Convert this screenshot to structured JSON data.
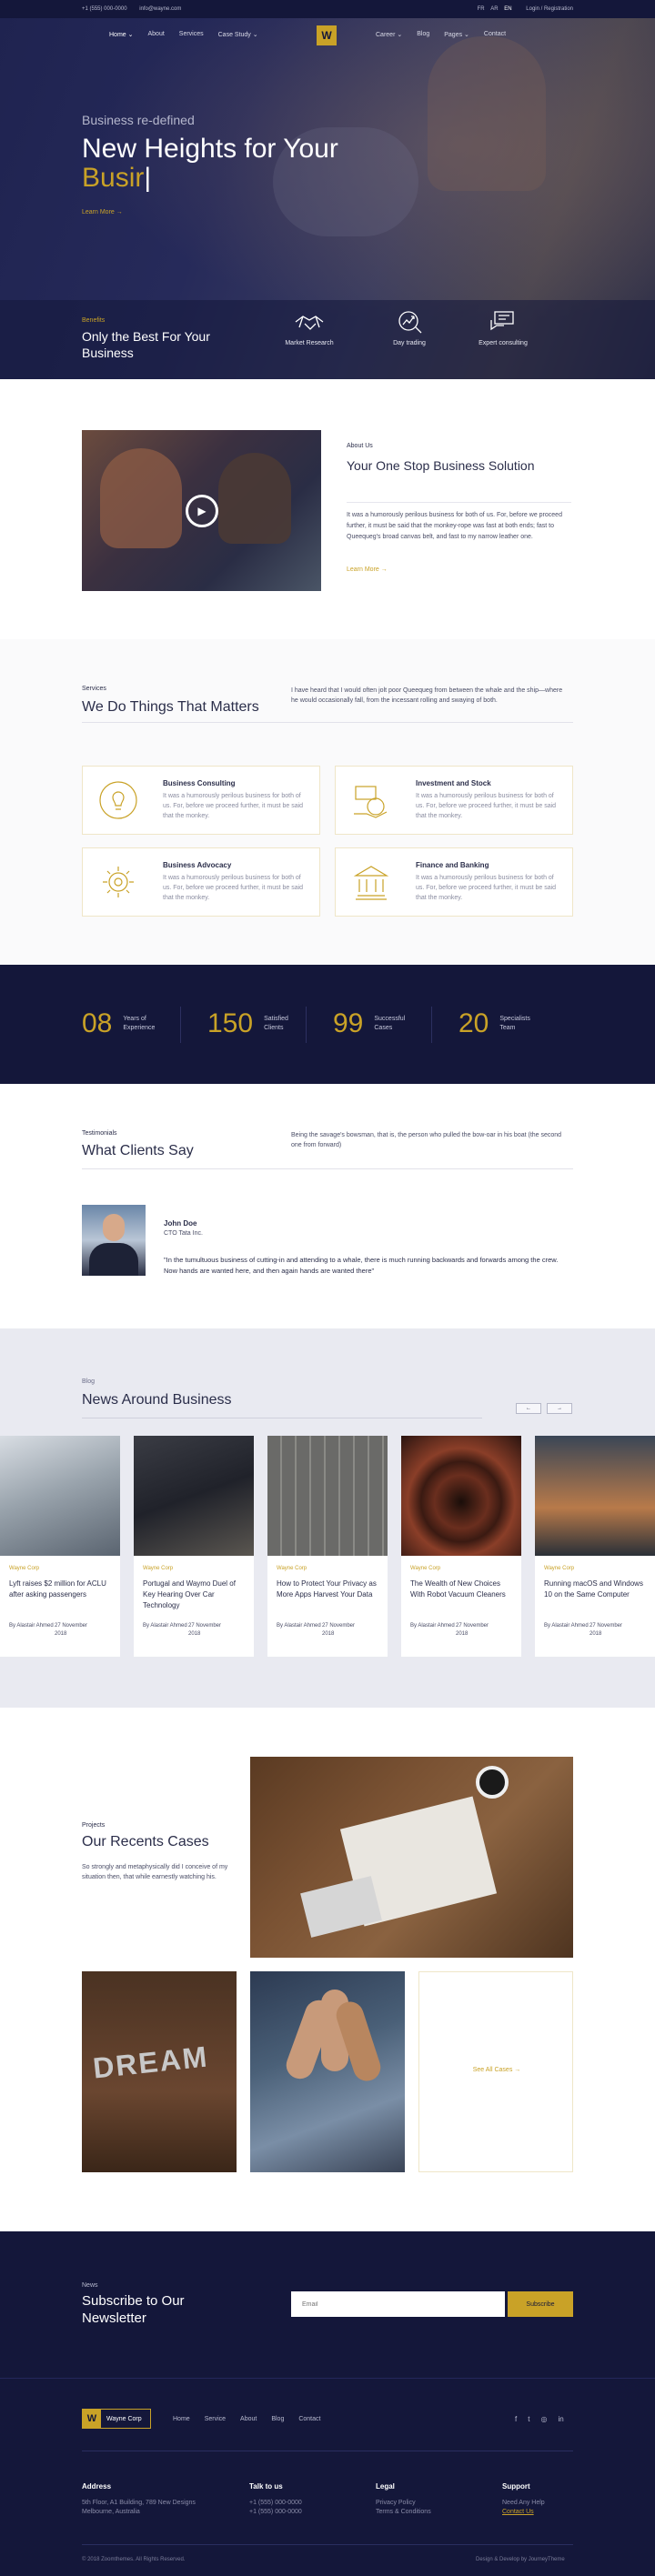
{
  "topbar": {
    "phone": "+1 (555) 000-0000",
    "email": "info@wayne.com",
    "langs": [
      "FR",
      "AR",
      "EN"
    ],
    "auth": "Login / Registration"
  },
  "nav": {
    "left": [
      "Home ⌄",
      "About",
      "Services",
      "Case Study ⌄"
    ],
    "right": [
      "Career ⌄",
      "Blog",
      "Pages ⌄",
      "Contact"
    ],
    "logo_letter": "W"
  },
  "hero": {
    "kicker": "Business re-defined",
    "title_line1": "New Heights for Your",
    "title_line2": "Busir",
    "cta": "Learn More  →"
  },
  "benefits": {
    "label": "Benefits",
    "title": "Only the Best For Your Business",
    "items": [
      "Market Research",
      "Day trading",
      "Expert consulting"
    ]
  },
  "about": {
    "kicker": "About Us",
    "title": "Your One Stop Business Solution",
    "text": "It was a humorously perilous business for both of us. For, before we proceed further, it must be said that the monkey-rope was fast at both ends; fast to Queequeg's broad canvas belt, and fast to my narrow leather one.",
    "more": "Learn More  →"
  },
  "services": {
    "kicker": "Services",
    "title": "We Do Things That Matters",
    "desc": "I have heard that I would often jolt poor Queequeg from between the whale and the ship—where he would occasionally fall, from the incessant rolling and swaying of both.",
    "cards": [
      {
        "title": "Business Consulting",
        "text": "It was a humorously perilous business for both of us. For, before we proceed further, it must be said that the monkey."
      },
      {
        "title": "Investment and Stock",
        "text": "It was a humorously perilous business for both of us. For, before we proceed further, it must be said that the monkey."
      },
      {
        "title": "Business Advocacy",
        "text": "It was a humorously perilous business for both of us. For, before we proceed further, it must be said that the monkey."
      },
      {
        "title": "Finance and Banking",
        "text": "It was a humorously perilous business for both of us. For, before we proceed further, it must be said that the monkey."
      }
    ]
  },
  "stats": [
    {
      "num": "08",
      "label": "Years of Experience"
    },
    {
      "num": "150",
      "label": "Satisfied Clients"
    },
    {
      "num": "99",
      "label": "Successful Cases"
    },
    {
      "num": "20",
      "label": "Specialists Team"
    }
  ],
  "testimonials": {
    "kicker": "Testimonials",
    "title": "What Clients Say",
    "desc": "Being the savage's bowsman, that is, the person who pulled the bow-oar in his boat (the second one from forward)",
    "name": "John Doe",
    "role": "CTO Tata Inc.",
    "quote": "\"In the tumultuous business of cutting-in and attending to a whale, there is much running backwards and forwards among the crew. Now hands are wanted here, and then again hands are wanted there\""
  },
  "blog": {
    "kicker": "Blog",
    "title": "News Around Business",
    "prev": "←",
    "next": "→",
    "posts": [
      {
        "cat": "Wayne Corp",
        "title": "Lyft raises $2 million for ACLU after asking passengers",
        "by": "By Alastair Ahmed",
        "date": "27 November 2018"
      },
      {
        "cat": "Wayne Corp",
        "title": "Portugal and Waymo Duel of Key Hearing Over Car Technology",
        "by": "By Alastair Ahmed",
        "date": "27 November 2018"
      },
      {
        "cat": "Wayne Corp",
        "title": "How to Protect Your Privacy as More Apps Harvest Your Data",
        "by": "By Alastair Ahmed",
        "date": "27 November 2018"
      },
      {
        "cat": "Wayne Corp",
        "title": "The Wealth of New Choices With Robot Vacuum Cleaners",
        "by": "By Alastair Ahmed",
        "date": "27 November 2018"
      },
      {
        "cat": "Wayne Corp",
        "title": "Running macOS and Windows 10 on the Same Computer",
        "by": "By Alastair Ahmed",
        "date": "27 November 2018"
      }
    ]
  },
  "projects": {
    "kicker": "Projects",
    "title": "Our Recents Cases",
    "desc": "So strongly and metaphysically did I conceive of my situation then, that while earnestly watching his.",
    "img_word": "DREAM",
    "see_all": "See All Cases  →"
  },
  "newsletter": {
    "kicker": "News",
    "title": "Subscribe to Our Newsletter",
    "placeholder": "Email",
    "button": "Subscribe"
  },
  "footer": {
    "brand": "Wayne Corp",
    "brand_letter": "W",
    "nav": [
      "Home",
      "Service",
      "About",
      "Blog",
      "Contact"
    ],
    "social": [
      "f",
      "t",
      "◎",
      "in"
    ],
    "address": {
      "h": "Address",
      "l1": "5th Floor, A1 Building, 789 New Designs",
      "l2": "Melbourne, Australia"
    },
    "talk": {
      "h": "Talk to us",
      "l1": "+1 (555) 000-0000",
      "l2": "+1 (555) 000-0000"
    },
    "legal": {
      "h": "Legal",
      "l1": "Privacy Policy",
      "l2": "Terms & Conditions"
    },
    "support": {
      "h": "Support",
      "l1": "Need Any Help",
      "l2": "Contact Us"
    },
    "copy": "© 2018 Zoomthemes. All Rights Reserved.",
    "credit": "Design & Develop by JourneyTheme"
  },
  "colors": {
    "navy": "#14173a",
    "gold": "#c9a227"
  }
}
